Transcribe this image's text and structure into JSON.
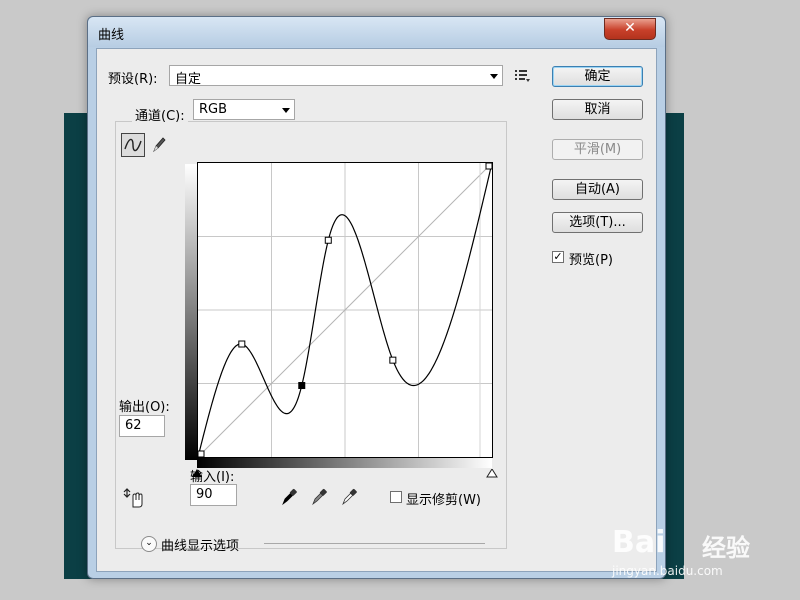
{
  "window": {
    "title": "曲线",
    "close_label": "✕"
  },
  "preset": {
    "label": "预设(R):",
    "value": "自定"
  },
  "channel": {
    "label": "通道(C):",
    "value": "RGB"
  },
  "buttons": {
    "ok": "确定",
    "cancel": "取消",
    "smooth": "平滑(M)",
    "auto": "自动(A)",
    "options": "选项(T)..."
  },
  "preview": {
    "label": "预览(P)",
    "checked": true
  },
  "output": {
    "label": "输出(O):",
    "value": "62"
  },
  "input": {
    "label": "输入(I):",
    "value": "90"
  },
  "show_clipping": {
    "label": "显示修剪(W)",
    "checked": false
  },
  "curve_display_options": {
    "label": "曲线显示选项"
  },
  "curve": {
    "control_points": [
      {
        "input": 0,
        "output": 0
      },
      {
        "input": 38,
        "output": 98
      },
      {
        "input": 90,
        "output": 62
      },
      {
        "input": 113,
        "output": 188
      },
      {
        "input": 169,
        "output": 84
      },
      {
        "input": 255,
        "output": 255
      }
    ],
    "selected_index": 2
  },
  "icons": {
    "curve_tool": "curve-tool-icon",
    "pencil_tool": "pencil-icon",
    "preset_menu": "preset-menu-icon",
    "hand_adjust": "on-image-adjust-icon",
    "black_eyedropper": "black-point-eyedropper-icon",
    "gray_eyedropper": "gray-point-eyedropper-icon",
    "white_eyedropper": "white-point-eyedropper-icon"
  },
  "watermark": {
    "logo_text": "Bai",
    "logo_text2": "经验",
    "sub": "jingyan.baidu.com"
  }
}
